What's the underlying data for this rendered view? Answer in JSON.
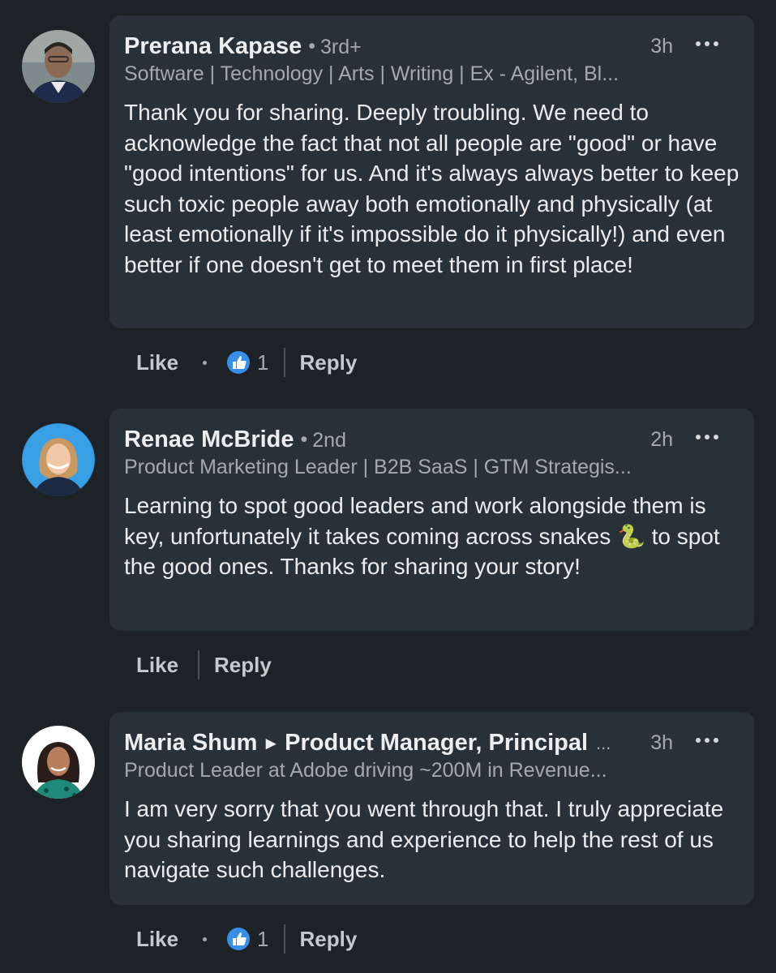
{
  "comments": [
    {
      "name": "Prerana Kapase",
      "degree": "3rd+",
      "time": "3h",
      "headline": "Software | Technology | Arts | Writing | Ex - Agilent, Bl...",
      "body": "Thank you for sharing. Deeply troubling. We need to acknowledge the fact that not all people are \"good\" or have \"good intentions\" for us. And it's always always better to keep such toxic people away both emotionally and physically (at least emotionally if it's impossible do it physically!) and even better if one doesn't get to meet them in first place!",
      "like_label": "Like",
      "reaction_count": "1",
      "reply_label": "Reply"
    },
    {
      "name": "Renae McBride",
      "degree": "2nd",
      "time": "2h",
      "headline": "Product Marketing Leader | B2B SaaS | GTM Strategis...",
      "body_before": "Learning to spot good leaders and work alongside them is key, unfortunately it takes coming across snakes ",
      "body_emoji": "🐍",
      "body_after": " to spot the good ones. Thanks for sharing your story!",
      "like_label": "Like",
      "reply_label": "Reply"
    },
    {
      "name": "Maria Shum",
      "name_arrow": "►",
      "name_title": "Product Manager, Principal",
      "name_ellipsis": "...",
      "time": "3h",
      "headline": "Product Leader at Adobe driving ~200M in Revenue...",
      "body": "I am very sorry that you went through that.  I truly appreciate you sharing learnings and experience to help the rest of us navigate such challenges.",
      "like_label": "Like",
      "reaction_count": "1",
      "reply_label": "Reply"
    }
  ],
  "colors": {
    "background": "#1d2226",
    "bubble": "#293138",
    "like_reaction": "#378fe9"
  },
  "icons": [
    "more-options-icon",
    "like-reaction-icon",
    "avatar"
  ]
}
